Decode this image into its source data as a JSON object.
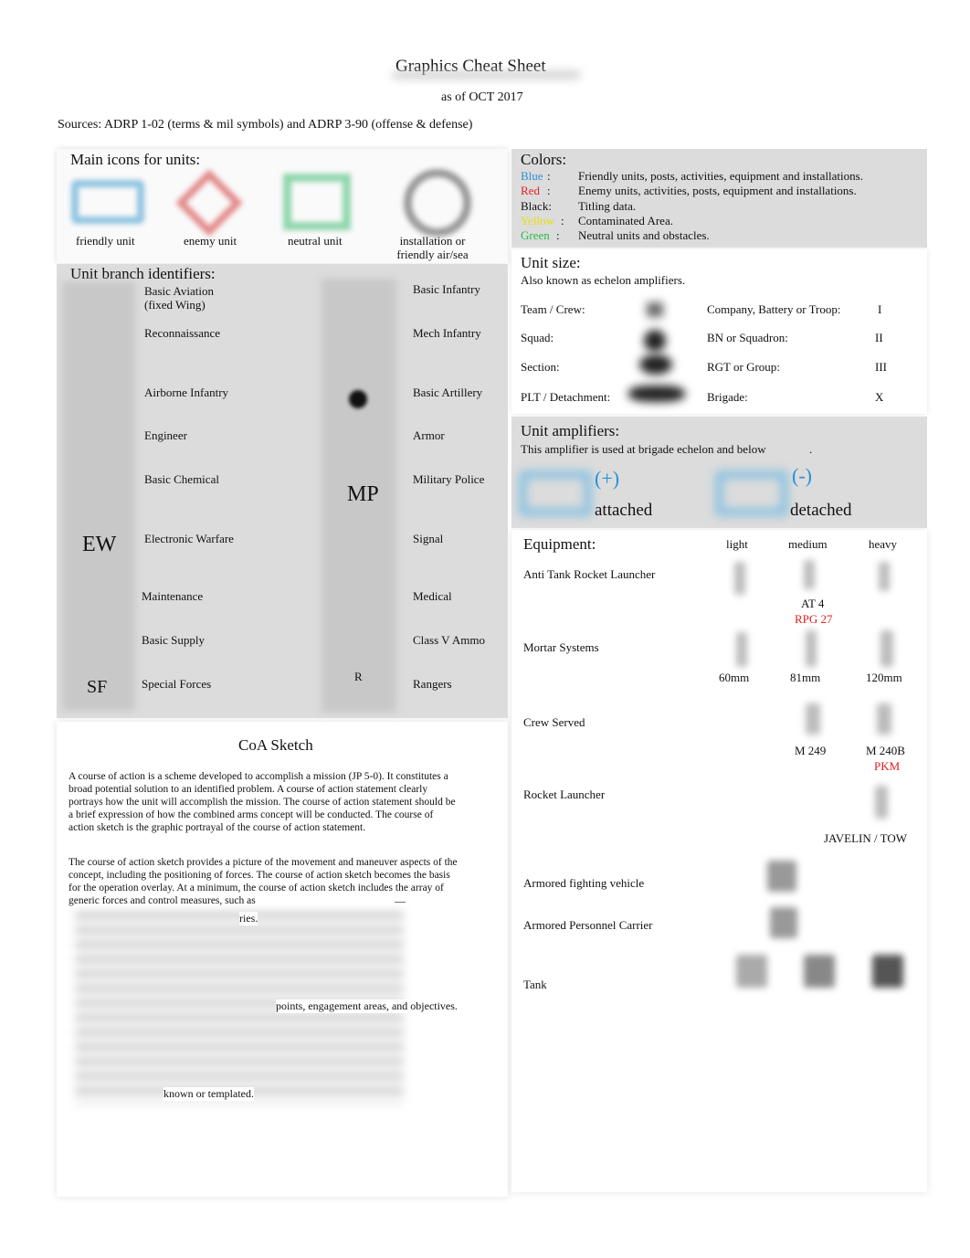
{
  "title": "Graphics Cheat Sheet",
  "subtitle": "as of OCT 2017",
  "sources": "Sources: ADRP 1-02 (terms & mil symbols) and ADRP 3-90 (offense & defense)",
  "main_icons": {
    "heading": "Main icons for units:",
    "items": [
      {
        "label": "friendly unit",
        "color": "#8ec3e0"
      },
      {
        "label": "enemy unit",
        "color": "#e38a8a"
      },
      {
        "label": "neutral unit",
        "color": "#8fd6ac"
      },
      {
        "label": "installation or friendly air/sea",
        "color": "#999999"
      }
    ]
  },
  "branch": {
    "heading": "Unit branch identifiers:",
    "left": [
      {
        "label": "Basic Aviation\n(fixed Wing)"
      },
      {
        "label": "Reconnaissance"
      },
      {
        "label": "Airborne Infantry"
      },
      {
        "label": "Engineer"
      },
      {
        "label": "Basic Chemical"
      },
      {
        "label": "Electronic Warfare",
        "symbol": "EW"
      },
      {
        "label": "Maintenance"
      },
      {
        "label": "Basic Supply"
      },
      {
        "label": "Special Forces",
        "symbol": "SF"
      }
    ],
    "right": [
      {
        "label": "Basic Infantry"
      },
      {
        "label": "Mech Infantry"
      },
      {
        "label": "Basic Artillery"
      },
      {
        "label": "Armor"
      },
      {
        "label": "Military Police",
        "symbol": "MP"
      },
      {
        "label": "Signal"
      },
      {
        "label": "Medical"
      },
      {
        "label": "Class V Ammo"
      },
      {
        "label": "Rangers",
        "symbol": "R"
      }
    ]
  },
  "coa": {
    "heading": "CoA Sketch",
    "p1": "A course of action   is a scheme developed to accomplish a mission (JP 5-0). It constitutes a broad potential solution to an identified problem. A course of action statement clearly portrays how the unit will accomplish the mission. The course of action statement should be a brief expression of how the combined arms concept will be conducted. The course of action sketch is the graphic portrayal of the course of action statement.",
    "p2": "The course of action sketch provides a picture of the movement and maneuver aspects of the concept, including the positioning of forces. The course of action sketch becomes the basis for the operation overlay. At a minimum, the course of action sketch includes the array of generic forces and control measures, such as",
    "dash": "—",
    "frag1": "ries.",
    "frag2": "points, engagement areas, and objectives.",
    "frag3": "known or templated."
  },
  "colors": {
    "heading": "Colors:",
    "items": [
      {
        "name": "Blue",
        "sep": ":",
        "desc": "Friendly units, posts, activities, equipment and installations.",
        "color": "#2a8fd6"
      },
      {
        "name": "Red",
        "sep": ":",
        "desc": "Enemy units, activities, posts, equipment and installations.",
        "color": "#e02020"
      },
      {
        "name": "Black:",
        "sep": "",
        "desc": "Titling data.",
        "color": "#111111"
      },
      {
        "name": "Yellow",
        "sep": ":",
        "desc": "Contaminated Area.",
        "color": "#e8e000"
      },
      {
        "name": "Green",
        "sep": ":",
        "desc": "Neutral units and obstacles.",
        "color": "#2db84a"
      }
    ]
  },
  "unit_size": {
    "heading": "Unit size:",
    "sub": "Also known as echelon amplifiers.",
    "left": [
      "Team / Crew:",
      "Squad:",
      "Section:",
      "PLT / Detachment:"
    ],
    "right": [
      {
        "label": "Company, Battery or Troop:",
        "sym": "I"
      },
      {
        "label": "BN or Squadron:",
        "sym": "II"
      },
      {
        "label": "RGT or Group:",
        "sym": "III"
      },
      {
        "label": "Brigade:",
        "sym": "X"
      }
    ]
  },
  "amplifiers": {
    "heading": "Unit amplifiers:",
    "sub": "This amplifier is used at brigade echelon and below",
    "dot": ".",
    "attached_sym": "(+)",
    "attached": "attached",
    "detached_sym": "(-)",
    "detached": "detached"
  },
  "equipment": {
    "heading": "Equipment:",
    "cols": [
      "light",
      "medium",
      "heavy"
    ],
    "rows": [
      {
        "label": "Anti Tank Rocket Launcher",
        "notes": [
          "AT 4"
        ],
        "red": "RPG 27"
      },
      {
        "label": "Mortar Systems",
        "notes": [
          "60mm",
          "81mm",
          "120mm"
        ]
      },
      {
        "label": "Crew Served",
        "notes": [
          "M 249",
          "M 240B"
        ],
        "red": "PKM"
      },
      {
        "label": "Rocket Launcher",
        "notes": [
          "JAVELIN / TOW"
        ]
      },
      {
        "label": "Armored fighting vehicle"
      },
      {
        "label": "Armored Personnel Carrier"
      },
      {
        "label": "Tank"
      }
    ]
  }
}
